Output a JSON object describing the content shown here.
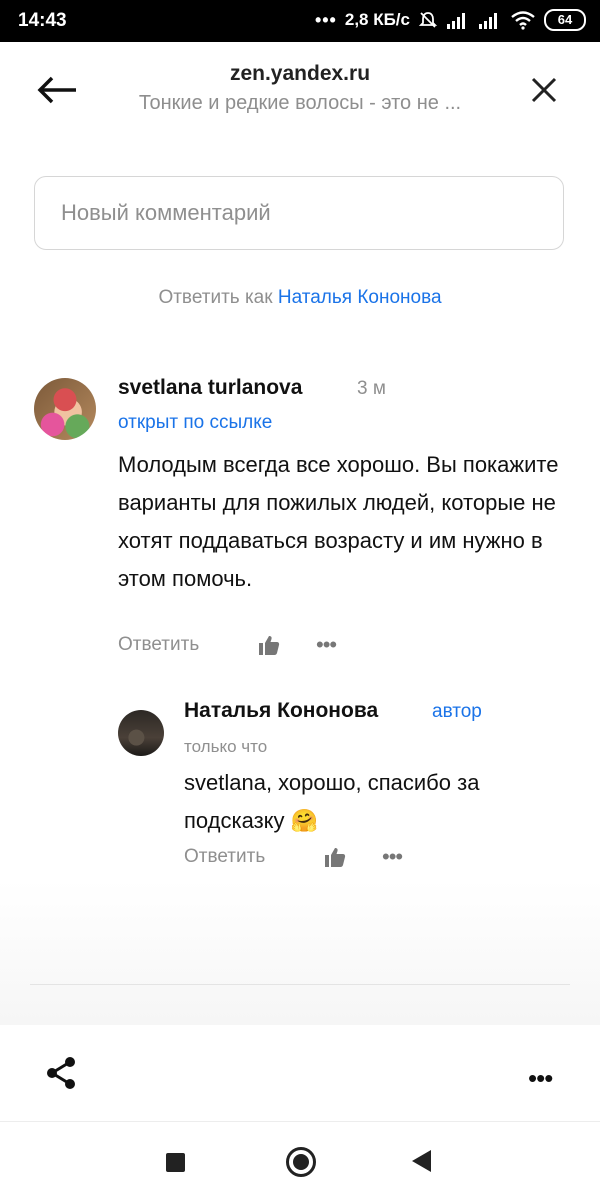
{
  "status_bar": {
    "time": "14:43",
    "dots": "•••",
    "speed": "2,8 КБ/с",
    "battery": "64"
  },
  "header": {
    "site": "zen.yandex.ru",
    "subtitle": "Тонкие и редкие волосы - это не ..."
  },
  "comment_box": {
    "placeholder": "Новый комментарий"
  },
  "reply_as": {
    "prefix": "Ответить как",
    "user": "Наталья Кононова"
  },
  "comments": [
    {
      "author": "svetlana turlanova",
      "time": "3 м",
      "source": "открыт по ссылке",
      "text": "Молодым всегда все хорошо. Вы покажите варианты для пожилых людей, которые не хотят поддаваться возрасту и им нужно в этом помочь.",
      "reply_label": "Ответить",
      "more": "•••"
    },
    {
      "author": "Наталья Кононова",
      "badge": "автор",
      "time": "только что",
      "text": "svetlana, хорошо, спасибо за подсказку 🤗",
      "reply_label": "Ответить",
      "more": "•••"
    }
  ],
  "bottom": {
    "menu": "•••"
  },
  "icons": {
    "back": "arrow-left",
    "close": "close",
    "like": "thumbs-up",
    "share": "share",
    "nav_recent": "square",
    "nav_home": "circle",
    "nav_back": "triangle-left"
  },
  "colors": {
    "accent": "#1a73e8",
    "muted": "#8f8f8f"
  }
}
